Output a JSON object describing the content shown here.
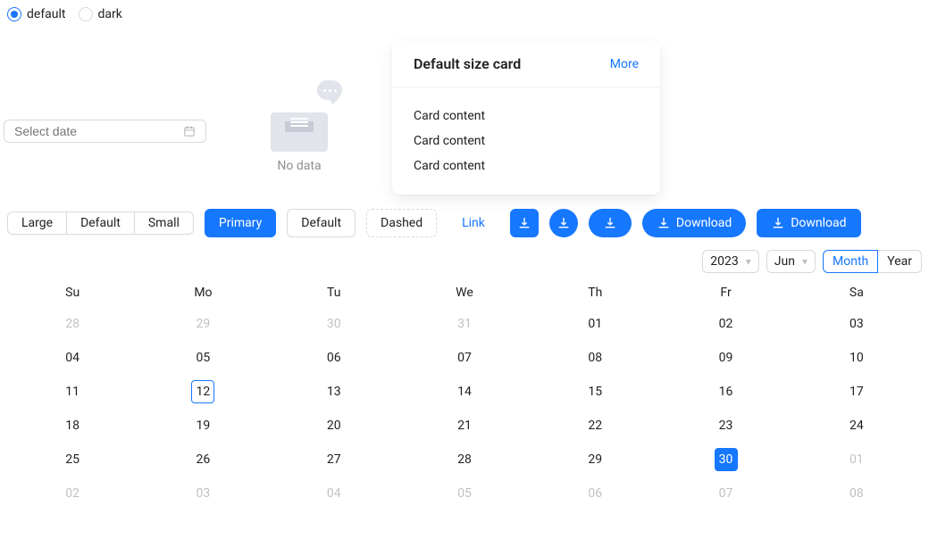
{
  "theme": {
    "options": [
      "default",
      "dark"
    ],
    "selected": 0
  },
  "datepicker": {
    "placeholder": "Select date",
    "value": ""
  },
  "empty": {
    "text": "No data"
  },
  "card": {
    "title": "Default size card",
    "extra": "More",
    "content": [
      "Card content",
      "Card content",
      "Card content"
    ]
  },
  "buttons": {
    "sizes": [
      "Large",
      "Default",
      "Small"
    ],
    "primary": "Primary",
    "default": "Default",
    "dashed": "Dashed",
    "link": "Link",
    "download": "Download"
  },
  "calendar": {
    "year": "2023",
    "month": "Jun",
    "mode": {
      "options": [
        "Month",
        "Year"
      ],
      "active": 0
    },
    "weekdays": [
      "Su",
      "Mo",
      "Tu",
      "We",
      "Th",
      "Fr",
      "Sa"
    ],
    "grid": [
      [
        {
          "d": "28",
          "out": true
        },
        {
          "d": "29",
          "out": true
        },
        {
          "d": "30",
          "out": true
        },
        {
          "d": "31",
          "out": true
        },
        {
          "d": "01"
        },
        {
          "d": "02"
        },
        {
          "d": "03"
        }
      ],
      [
        {
          "d": "04"
        },
        {
          "d": "05"
        },
        {
          "d": "06"
        },
        {
          "d": "07"
        },
        {
          "d": "08"
        },
        {
          "d": "09"
        },
        {
          "d": "10"
        }
      ],
      [
        {
          "d": "11"
        },
        {
          "d": "12",
          "today": true
        },
        {
          "d": "13"
        },
        {
          "d": "14"
        },
        {
          "d": "15"
        },
        {
          "d": "16"
        },
        {
          "d": "17"
        }
      ],
      [
        {
          "d": "18"
        },
        {
          "d": "19"
        },
        {
          "d": "20"
        },
        {
          "d": "21"
        },
        {
          "d": "22"
        },
        {
          "d": "23"
        },
        {
          "d": "24"
        }
      ],
      [
        {
          "d": "25"
        },
        {
          "d": "26"
        },
        {
          "d": "27"
        },
        {
          "d": "28"
        },
        {
          "d": "29"
        },
        {
          "d": "30",
          "selected": true
        },
        {
          "d": "01",
          "out": true
        }
      ],
      [
        {
          "d": "02",
          "out": true
        },
        {
          "d": "03",
          "out": true
        },
        {
          "d": "04",
          "out": true
        },
        {
          "d": "05",
          "out": true
        },
        {
          "d": "06",
          "out": true
        },
        {
          "d": "07",
          "out": true
        },
        {
          "d": "08",
          "out": true
        }
      ]
    ]
  }
}
